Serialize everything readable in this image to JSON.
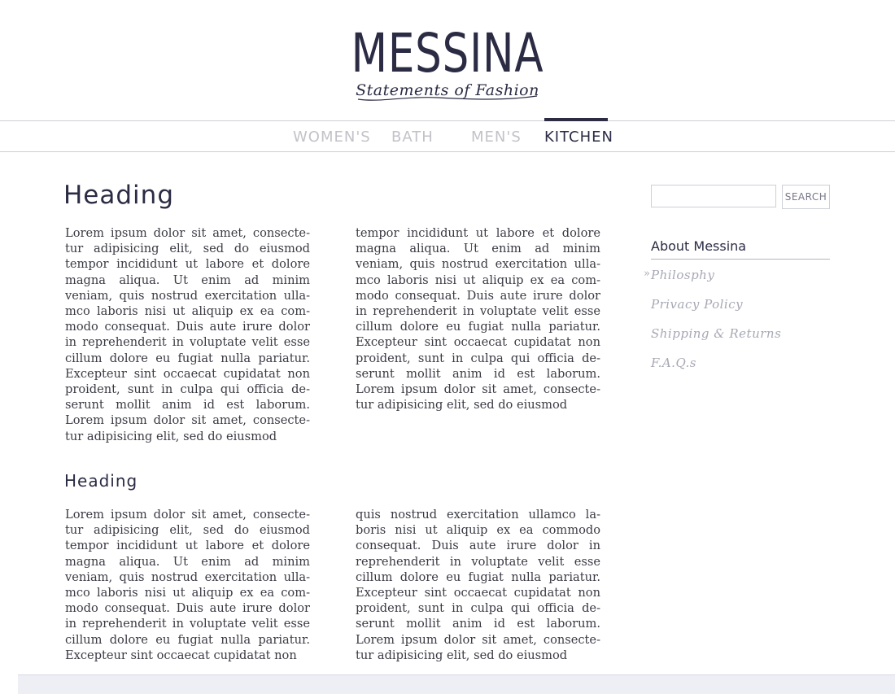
{
  "brand": {
    "title": "MESSINA",
    "tagline": "Statements of Fashion",
    "color": "#2b2c44"
  },
  "nav": {
    "items": [
      {
        "label": "WOMEN'S"
      },
      {
        "label": "BATH"
      },
      {
        "label": "MEN'S"
      },
      {
        "label": "KITCHEN"
      }
    ],
    "active": "KITCHEN"
  },
  "main": {
    "section1": {
      "heading": "Heading",
      "col1": "Lorem ipsum dolor sit amet, consecte­tur adipisicing elit, sed do eiusmod tempor incididunt ut labore et dolore magna aliqua. Ut enim ad minim veniam, quis nostrud exercitation ulla­mco laboris nisi ut aliquip ex ea com­modo consequat. Duis aute irure dolor in reprehenderit in voluptate velit esse cillum dolore eu fugiat nulla pariatur. Excepteur sint occaecat cupidatat non proident, sunt in culpa qui officia de­serunt mollit anim id est laborum. Lorem ipsum dolor sit amet, consecte­tur adipisicing elit, sed do eiusmod",
      "col2": "tempor incididunt ut labore et dolore magna aliqua. Ut enim ad minim veniam, quis nostrud exercitation ulla­mco laboris nisi ut aliquip ex ea com­modo consequat. Duis aute irure dolor in reprehenderit in voluptate velit esse cillum dolore eu fugiat nulla pariatur. Excepteur sint occaecat cupidatat non proident, sunt in culpa qui officia de­serunt mollit anim id est laborum. Lorem ipsum dolor sit amet, consecte­tur adipisicing elit, sed do eiusmod"
    },
    "section2": {
      "heading": "Heading",
      "col1": "Lorem ipsum dolor sit amet, consecte­tur adipisicing elit, sed do eiusmod tempor incididunt ut labore et dolore magna aliqua. Ut enim ad minim veniam, quis nostrud exercitation ulla­mco laboris nisi ut aliquip ex ea com­modo consequat. Duis aute irure dolor in reprehenderit in voluptate velit esse cillum dolore eu fugiat nulla pariatur. Excepteur sint occaecat cupidatat non",
      "col2": "quis nostrud exercitation ullamco la­boris nisi ut aliquip ex ea commodo consequat. Duis aute irure dolor in reprehenderit in voluptate velit esse cillum dolore eu fugiat nulla pariatur. Excepteur sint occaecat cupidatat non proident, sunt in culpa qui officia de­serunt mollit anim id est laborum. Lorem ipsum dolor sit amet, consecte­tur adipisicing elit, sed do eiusmod"
    }
  },
  "sidebar": {
    "search": {
      "value": "",
      "placeholder": "",
      "button_label": "SEARCH"
    },
    "title": "About Messina",
    "arrow": "»",
    "links": [
      {
        "label": "Philosphy"
      },
      {
        "label": "Privacy Policy"
      },
      {
        "label": "Shipping & Returns"
      },
      {
        "label": "F.A.Q.s"
      }
    ]
  }
}
